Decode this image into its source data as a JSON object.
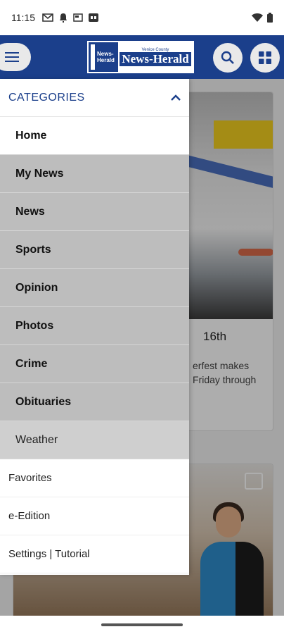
{
  "status_bar": {
    "time": "11:15",
    "left_icons": [
      "gmail-icon",
      "notification-icon",
      "news-icon",
      "captions-icon"
    ],
    "right_icons": [
      "wifi-icon",
      "battery-icon"
    ]
  },
  "app_bar": {
    "menu_icon": "hamburger-icon",
    "logo": {
      "small_left": "News-Herald",
      "subtitle": "Venice County",
      "title": "News-Herald"
    },
    "search_icon": "search-icon",
    "grid_icon": "grid-icon"
  },
  "drawer": {
    "header": "CATEGORIES",
    "header_icon": "chevron-up-icon",
    "categories": [
      {
        "label": "Home",
        "style": "active"
      },
      {
        "label": "My News",
        "style": "normal"
      },
      {
        "label": "News",
        "style": "normal"
      },
      {
        "label": "Sports",
        "style": "normal"
      },
      {
        "label": "Opinion",
        "style": "normal"
      },
      {
        "label": "Photos",
        "style": "normal"
      },
      {
        "label": "Crime",
        "style": "normal"
      },
      {
        "label": "Obituaries",
        "style": "normal"
      },
      {
        "label": "Weather",
        "style": "light"
      }
    ],
    "extras": [
      {
        "label": "Favorites"
      },
      {
        "label": "e-Edition"
      },
      {
        "label": "Settings | Tutorial"
      }
    ]
  },
  "feed": {
    "card1": {
      "title_fragment": "16th",
      "desc_fragment": "erfest makes Friday through"
    },
    "card2": {
      "gallery_icon": "gallery-icon"
    }
  },
  "colors": {
    "brand": "#1b3f8b",
    "drawer_item_bg": "#bdbdbd"
  }
}
